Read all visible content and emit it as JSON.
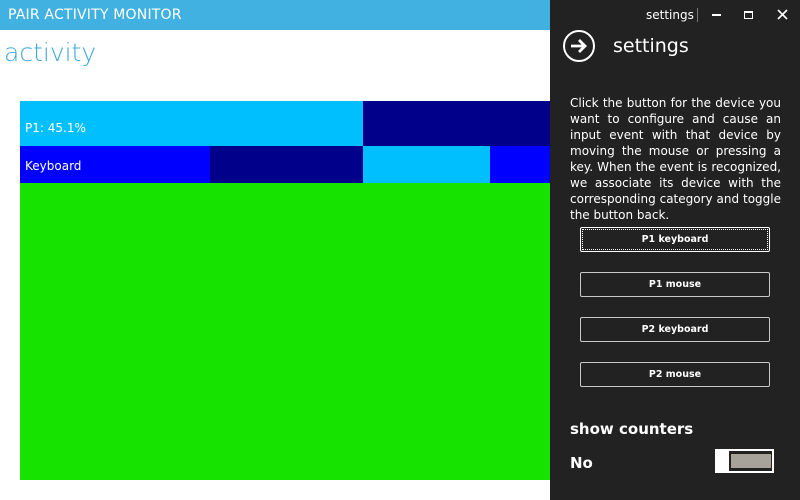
{
  "window": {
    "title": "PAIR ACTIVITY MONITOR",
    "caption_label": "settings",
    "colors": {
      "titlebar": "#41b1e1",
      "panel": "#222222"
    }
  },
  "main": {
    "page_title": "activity",
    "rows": [
      {
        "label": "P1: 45.1%"
      },
      {
        "label": "Keyboard"
      }
    ],
    "colors": {
      "cyan": "#00bfff",
      "navy": "#00008b",
      "blue": "#0000ff",
      "green": "#16e400"
    }
  },
  "settings": {
    "title": "settings",
    "help_text": "Click the button for the device you want to configure and cause an input event with that device by moving the mouse or pressing a key. When the event is recognized, we associate its device with the corresponding category and toggle the button back.",
    "buttons": [
      {
        "label": "P1 keyboard"
      },
      {
        "label": "P1 mouse"
      },
      {
        "label": "P2 keyboard"
      },
      {
        "label": "P2 mouse"
      }
    ],
    "show_counters": {
      "label": "show counters",
      "state_text": "No",
      "value": false
    }
  },
  "icons": {
    "back": "arrow-right-circle-icon",
    "minimize": "minimize-icon",
    "maximize": "maximize-icon",
    "close": "close-icon"
  }
}
